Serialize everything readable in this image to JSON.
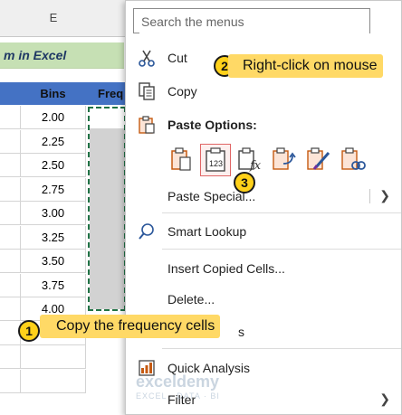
{
  "sheet": {
    "column_letter": "E",
    "title_fragment": "m in Excel",
    "bins_header": "Bins",
    "freq_header_fragment": "Freq",
    "bins": [
      "2.00",
      "2.25",
      "2.50",
      "2.75",
      "3.00",
      "3.25",
      "3.50",
      "3.75",
      "4.00"
    ],
    "selection_color": "#217346",
    "header_color": "#4472c4",
    "title_fill": "#c6e0b4"
  },
  "menu": {
    "search_placeholder": "Search the menus",
    "cut": "Cut",
    "copy": "Copy",
    "paste_options_label": "Paste Options:",
    "paste_values_caption": "123",
    "paste_special": "Paste Special...",
    "smart_lookup": "Smart Lookup",
    "insert_copied_cells": "Insert Copied Cells...",
    "delete": "Delete...",
    "partial_item_tail": "s",
    "quick_analysis": "Quick Analysis",
    "filter": "Filter",
    "submenu_arrow": "❯"
  },
  "callouts": [
    {
      "number": "1",
      "text": "Copy the frequency cells"
    },
    {
      "number": "2",
      "text": "Right-click on mouse"
    },
    {
      "number": "3",
      "text": ""
    }
  ],
  "watermark": {
    "brand": "exceldemy",
    "tagline": "EXCEL · DATA · BI"
  }
}
